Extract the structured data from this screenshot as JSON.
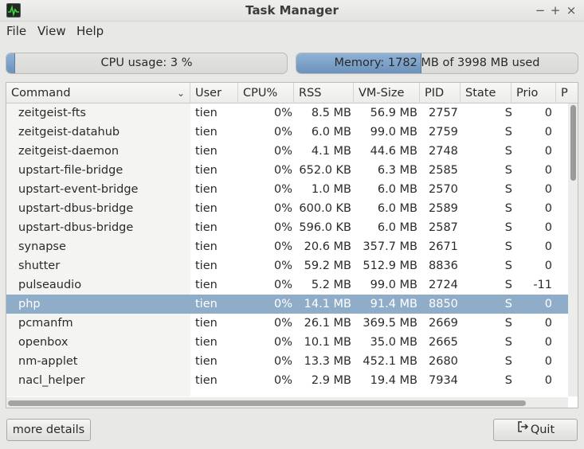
{
  "window": {
    "title": "Task Manager",
    "minimize": "−",
    "maximize": "+",
    "close": "×"
  },
  "menu": {
    "file": "File",
    "view": "View",
    "help": "Help"
  },
  "cpu": {
    "label": "CPU usage: 3 %",
    "percent": 3
  },
  "memory": {
    "label": "Memory: 1782 MB of 3998 MB used",
    "used_mb": 1782,
    "total_mb": 3998
  },
  "columns": [
    "Command",
    "User",
    "CPU%",
    "RSS",
    "VM-Size",
    "PID",
    "State",
    "Prio",
    "P"
  ],
  "rows": [
    {
      "command": "zeitgeist-fts",
      "user": "tien",
      "cpu": "0%",
      "rss": "8.5 MB",
      "vm": "56.9 MB",
      "pid": "2757",
      "state": "S",
      "prio": "0"
    },
    {
      "command": "zeitgeist-datahub",
      "user": "tien",
      "cpu": "0%",
      "rss": "6.0 MB",
      "vm": "99.0 MB",
      "pid": "2759",
      "state": "S",
      "prio": "0"
    },
    {
      "command": "zeitgeist-daemon",
      "user": "tien",
      "cpu": "0%",
      "rss": "4.1 MB",
      "vm": "44.6 MB",
      "pid": "2748",
      "state": "S",
      "prio": "0"
    },
    {
      "command": "upstart-file-bridge",
      "user": "tien",
      "cpu": "0%",
      "rss": "652.0 KB",
      "vm": "6.3 MB",
      "pid": "2585",
      "state": "S",
      "prio": "0"
    },
    {
      "command": "upstart-event-bridge",
      "user": "tien",
      "cpu": "0%",
      "rss": "1.0 MB",
      "vm": "6.0 MB",
      "pid": "2570",
      "state": "S",
      "prio": "0"
    },
    {
      "command": "upstart-dbus-bridge",
      "user": "tien",
      "cpu": "0%",
      "rss": "600.0 KB",
      "vm": "6.0 MB",
      "pid": "2589",
      "state": "S",
      "prio": "0"
    },
    {
      "command": "upstart-dbus-bridge",
      "user": "tien",
      "cpu": "0%",
      "rss": "596.0 KB",
      "vm": "6.0 MB",
      "pid": "2587",
      "state": "S",
      "prio": "0"
    },
    {
      "command": "synapse",
      "user": "tien",
      "cpu": "0%",
      "rss": "20.6 MB",
      "vm": "357.7 MB",
      "pid": "2671",
      "state": "S",
      "prio": "0"
    },
    {
      "command": "shutter",
      "user": "tien",
      "cpu": "0%",
      "rss": "59.2 MB",
      "vm": "512.9 MB",
      "pid": "8836",
      "state": "S",
      "prio": "0"
    },
    {
      "command": "pulseaudio",
      "user": "tien",
      "cpu": "0%",
      "rss": "5.2 MB",
      "vm": "99.0 MB",
      "pid": "2724",
      "state": "S",
      "prio": "-11"
    },
    {
      "command": "php",
      "user": "tien",
      "cpu": "0%",
      "rss": "14.1 MB",
      "vm": "91.4 MB",
      "pid": "8850",
      "state": "S",
      "prio": "0",
      "selected": true
    },
    {
      "command": "pcmanfm",
      "user": "tien",
      "cpu": "0%",
      "rss": "26.1 MB",
      "vm": "369.5 MB",
      "pid": "2669",
      "state": "S",
      "prio": "0"
    },
    {
      "command": "openbox",
      "user": "tien",
      "cpu": "0%",
      "rss": "10.1 MB",
      "vm": "35.0 MB",
      "pid": "2665",
      "state": "S",
      "prio": "0"
    },
    {
      "command": "nm-applet",
      "user": "tien",
      "cpu": "0%",
      "rss": "13.3 MB",
      "vm": "452.1 MB",
      "pid": "2680",
      "state": "S",
      "prio": "0"
    },
    {
      "command": "nacl_helper",
      "user": "tien",
      "cpu": "0%",
      "rss": "2.9 MB",
      "vm": "19.4 MB",
      "pid": "7934",
      "state": "S",
      "prio": "0"
    }
  ],
  "buttons": {
    "more_details": "more details",
    "quit": "Quit"
  },
  "colors": {
    "selection": "#8fadc9",
    "progress": "#7ea3c9"
  }
}
